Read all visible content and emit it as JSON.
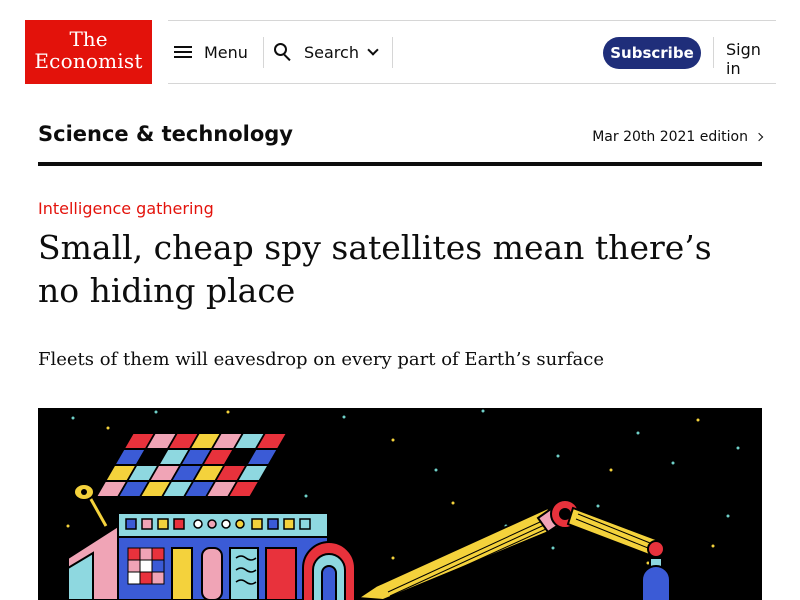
{
  "header": {
    "logo": {
      "line1": "The",
      "line2": "Economist"
    },
    "menu_label": "Menu",
    "search_label": "Search",
    "subscribe_label": "Subscribe",
    "signin_label": "Sign in"
  },
  "section": {
    "title": "Science & technology",
    "edition": "Mar 20th 2021 edition"
  },
  "article": {
    "rubric": "Intelligence gathering",
    "headline": "Small, cheap spy satellites mean there’s no hiding place",
    "standfirst": "Fleets of them will eavesdrop on every part of Earth’s surface"
  },
  "colors": {
    "brand_red": "#e3120b",
    "subscribe_blue": "#1f2e7a",
    "text": "#0d0d0d",
    "divider": "#d6d6d6"
  },
  "icons": [
    "menu-icon",
    "search-icon",
    "chevron-down-icon",
    "chevron-right-icon"
  ]
}
